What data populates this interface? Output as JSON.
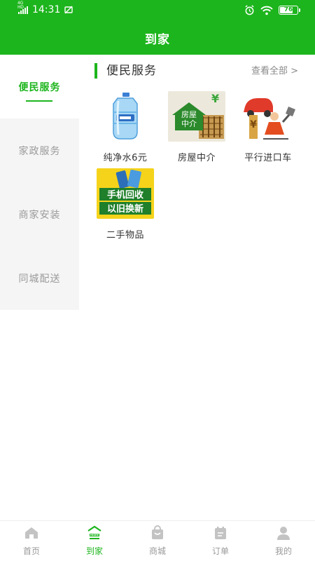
{
  "status": {
    "net_label": "4G HD",
    "time": "14:31",
    "battery": "76"
  },
  "header": {
    "title": "到家"
  },
  "sidebar": {
    "items": [
      {
        "label": "便民服务",
        "active": true
      },
      {
        "label": "家政服务",
        "active": false
      },
      {
        "label": "商家安装",
        "active": false
      },
      {
        "label": "同城配送",
        "active": false
      }
    ]
  },
  "section": {
    "title": "便民服务",
    "view_all": "查看全部 >"
  },
  "services": [
    {
      "label": "纯净水6元",
      "icon": "water-jug"
    },
    {
      "label": "房屋中介",
      "icon": "house-agent",
      "art": {
        "line1": "房屋",
        "line2": "中介",
        "currency": "¥"
      }
    },
    {
      "label": "平行进口车",
      "icon": "imported-car"
    },
    {
      "label": "二手物品",
      "icon": "phone-tradein",
      "art": {
        "line1": "手机回收",
        "line2": "以旧换新"
      }
    }
  ],
  "tabbar": {
    "items": [
      {
        "label": "首页",
        "icon": "home-icon",
        "active": false
      },
      {
        "label": "到家",
        "icon": "house-badge-icon",
        "badge": "HIGEE",
        "active": true
      },
      {
        "label": "商城",
        "icon": "shopping-bag-icon",
        "active": false
      },
      {
        "label": "订单",
        "icon": "order-icon",
        "active": false
      },
      {
        "label": "我的",
        "icon": "profile-icon",
        "active": false
      }
    ]
  },
  "colors": {
    "brand": "#1db51d",
    "inactive_text": "#9a9a9a",
    "sidebar_bg": "#f5f5f5"
  }
}
